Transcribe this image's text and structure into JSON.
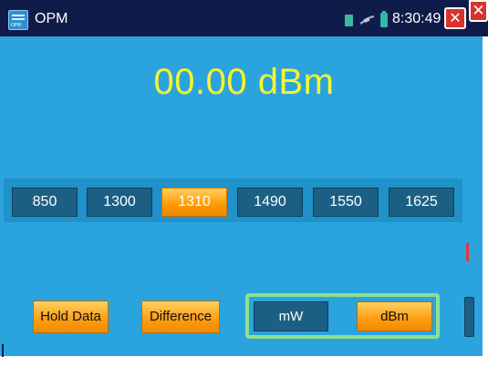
{
  "titlebar": {
    "app_icon_text": "OPM",
    "title": "OPM",
    "time": "8:30:49 AM",
    "icons": [
      "app-icon",
      "sd-card-icon",
      "cable-icon",
      "battery-icon",
      "close-icon",
      "close-icon"
    ]
  },
  "display": {
    "power_reading": "00.00 dBm",
    "reading_color": "#f7f530"
  },
  "wavelengths": {
    "items": [
      "850",
      "1300",
      "1310",
      "1490",
      "1550",
      "1625"
    ],
    "selected": "1310"
  },
  "controls": {
    "hold_label": "Hold Data",
    "difference_label": "Difference",
    "unit_mw": "mW",
    "unit_dbm": "dBm",
    "selected_unit": "dBm"
  },
  "colors": {
    "titlebar": "#0f1b48",
    "panel": "#2ba4dd",
    "button_normal": "#1c5f84",
    "button_active": "#ff9800",
    "group_border": "#8fe08f",
    "close": "#d9342b"
  }
}
